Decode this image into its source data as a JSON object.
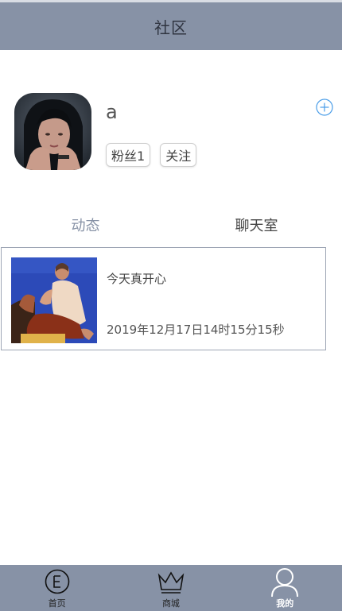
{
  "header": {
    "title": "社区"
  },
  "profile": {
    "username": "a",
    "chips": [
      "粉丝1",
      "关注"
    ]
  },
  "tabs": [
    {
      "label": "动态",
      "active": true
    },
    {
      "label": "聊天室",
      "active": false
    }
  ],
  "posts": [
    {
      "text": "今天真开心",
      "time": "2019年12月17日14时15分15秒"
    }
  ],
  "bottom_nav": [
    {
      "label": "首页",
      "icon": "e-circle-icon",
      "active": false
    },
    {
      "label": "商城",
      "icon": "crown-icon",
      "active": false
    },
    {
      "label": "我的",
      "icon": "user-icon",
      "active": true
    }
  ],
  "colors": {
    "header_bg": "#8792a6",
    "accent": "#8792a6",
    "add_icon": "#4a9de8"
  }
}
